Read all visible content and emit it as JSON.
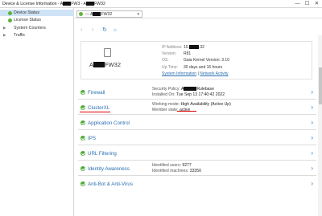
{
  "window": {
    "title_prefix": "Device & License Information - A",
    "title_mid": "FW3 - A",
    "title_suffix": "FW32",
    "min": "—",
    "max": "☐",
    "close": "✕"
  },
  "sidebar": {
    "items": [
      {
        "label": "Device Status",
        "selected": true
      },
      {
        "label": "License Status",
        "selected": false
      },
      {
        "label": "System Counters",
        "selected": false
      },
      {
        "label": "Traffic",
        "selected": false
      }
    ]
  },
  "device_selector": {
    "name_prefix": "A",
    "name_suffix": "FW32"
  },
  "device_card": {
    "name_prefix": "A",
    "name_suffix": "FW32",
    "ip_label": "IP Address:",
    "ip_value_prefix": "10.",
    "ip_value_suffix": ".32",
    "version_label": "Version:",
    "version_value": "R81",
    "os_label": "OS:",
    "os_value": "Gaia Kernel Version: 3.10",
    "uptime_label": "Up Time:",
    "uptime_value": "30 days and 16 hours",
    "link1": "System Information",
    "link_sep": "|",
    "link2": "Network Activity"
  },
  "blades": [
    {
      "name": "Firewall",
      "l1_key": "Security Policy:",
      "l1_prefix": "A",
      "l1_suffix": "Rulebase",
      "l2_key": "Installed On:",
      "l2_val": "Tue Sep 13 17:40:42 2022"
    },
    {
      "name": "ClusterXL",
      "l1_key": "Working mode:",
      "l1_val": "High Availability (Active Up)",
      "l2_key": "Member state:",
      "l2_val": "active"
    },
    {
      "name": "Application Control"
    },
    {
      "name": "IPS"
    },
    {
      "name": "URL Filtering"
    },
    {
      "name": "Identity Awareness",
      "l1_key": "Identified users:",
      "l1_val": "9277",
      "l2_key": "Identified machines:",
      "l2_val": "33350"
    },
    {
      "name": "Anti-Bot & Anti-Virus"
    }
  ],
  "colors": {
    "accent": "#2a6fb0",
    "ok": "#4caa32",
    "annotation": "#dd0000",
    "selected": "#cfe3f6"
  }
}
